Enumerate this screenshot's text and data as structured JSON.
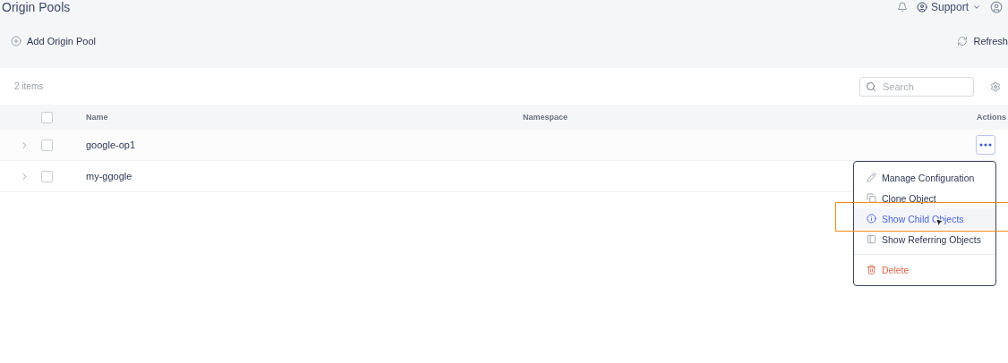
{
  "header": {
    "title": "Origin Pools",
    "user_menu": "Support"
  },
  "toolbar": {
    "add_button": "Add Origin Pool",
    "refresh_button": "Refresh"
  },
  "list": {
    "count": "2 items",
    "search": {
      "placeholder": "Search"
    }
  },
  "table": {
    "select_all_checked": false,
    "columns": [
      "Name",
      "Namespace",
      "Actions"
    ],
    "rows": [
      {
        "name": "google-op1",
        "checked": false,
        "expanded": false,
        "menu_open": true
      },
      {
        "name": "my-ggogle",
        "checked": false,
        "expanded": false,
        "menu_open": false
      }
    ]
  },
  "action_menu": {
    "items": [
      {
        "kind": "edit",
        "label": "Manage Configuration",
        "selected": false
      },
      {
        "kind": "clone",
        "label": "Clone Object",
        "selected": false
      },
      {
        "kind": "info",
        "label": "Show Child Objects",
        "selected": true
      },
      {
        "kind": "refs",
        "label": "Show Referring Objects",
        "selected": false
      },
      {
        "kind": "delete",
        "label": "Delete",
        "selected": false
      }
    ]
  }
}
